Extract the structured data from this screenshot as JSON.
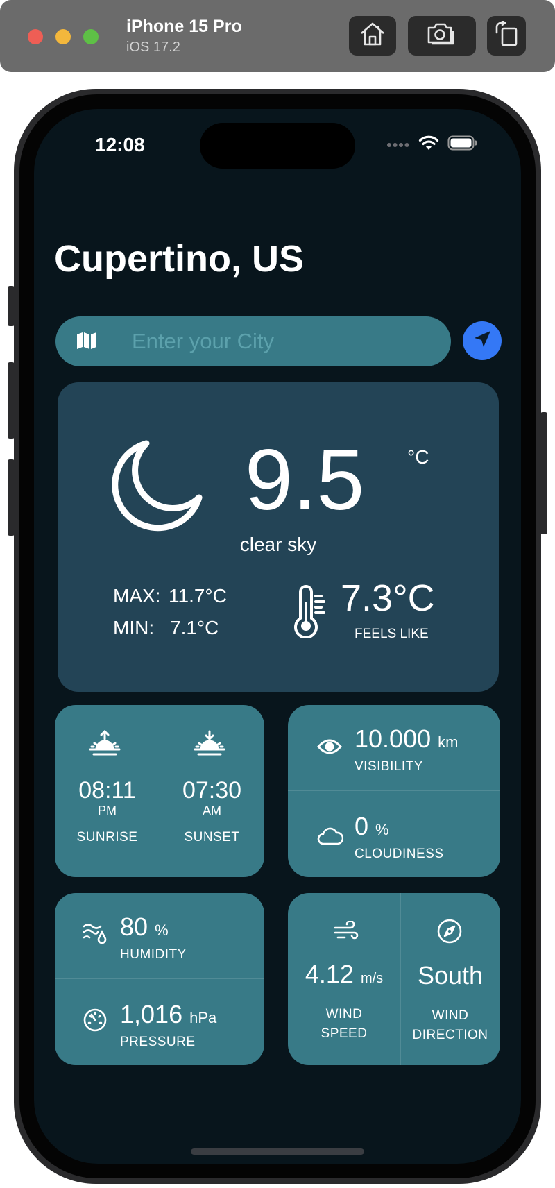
{
  "simulator": {
    "device_name": "iPhone 15 Pro",
    "os_version": "iOS 17.2",
    "buttons": [
      "home-icon",
      "screenshot-icon",
      "rotate-icon"
    ]
  },
  "status_bar": {
    "time": "12:08"
  },
  "header": {
    "city": "Cupertino, US"
  },
  "search": {
    "placeholder": "Enter your City",
    "value": ""
  },
  "current": {
    "icon": "moon-icon",
    "temperature": "9.5",
    "unit": "°C",
    "condition": "clear sky",
    "max_label": "MAX:",
    "max_value": "11.7°C",
    "min_label": "MIN:",
    "min_value": "7.1°C",
    "feels_like_value": "7.3°C",
    "feels_like_label": "FEELS LIKE"
  },
  "sun": {
    "sunrise_time": "08:11",
    "sunrise_period": "PM",
    "sunrise_label": "SUNRISE",
    "sunset_time": "07:30",
    "sunset_period": "AM",
    "sunset_label": "SUNSET"
  },
  "visibility": {
    "value": "10.000",
    "unit": "km",
    "label": "VISIBILITY"
  },
  "cloudiness": {
    "value": "0",
    "unit": "%",
    "label": "CLOUDINESS"
  },
  "humidity": {
    "value": "80",
    "unit": "%",
    "label": "HUMIDITY"
  },
  "pressure": {
    "value": "1,016",
    "unit": "hPa",
    "label": "PRESSURE"
  },
  "wind": {
    "speed_value": "4.12",
    "speed_unit": "m/s",
    "speed_label_1": "WIND",
    "speed_label_2": "SPEED",
    "direction_value": "South",
    "direction_label_1": "WIND",
    "direction_label_2": "DIRECTION"
  },
  "colors": {
    "toolbar": "#6b6b6b",
    "screen_bg": "#08151c",
    "main_card": "#234456",
    "tile": "#387a87",
    "locate_button": "#3478f6",
    "placeholder": "#5ca1ac"
  }
}
